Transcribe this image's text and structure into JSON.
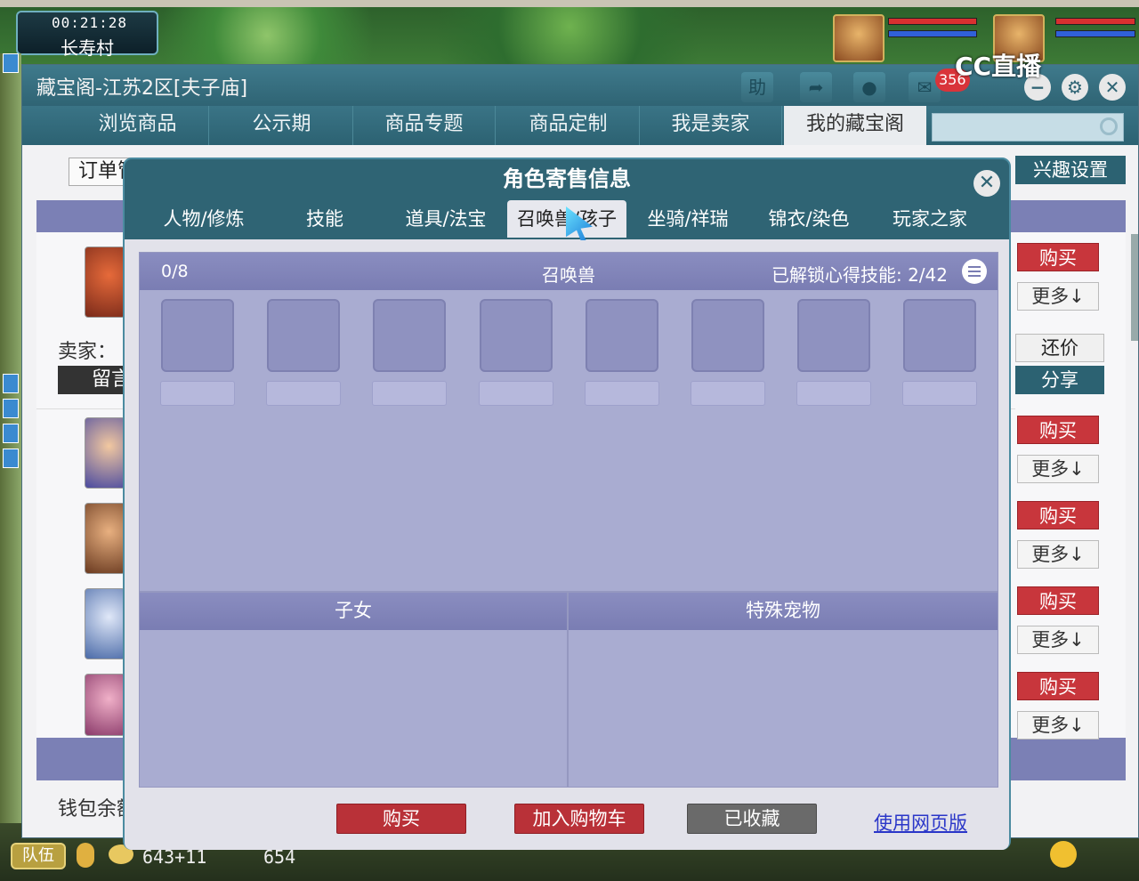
{
  "game": {
    "time": "00:21:28",
    "location": "长寿村",
    "stream_logo": "CC直播",
    "team_label": "队伍",
    "coords": "643+11",
    "coords2": "654"
  },
  "window": {
    "title": "藏宝阁-江苏2区[夫子庙]",
    "help_label": "助",
    "cart_count": "356",
    "nav": [
      "浏览商品",
      "公示期",
      "商品专题",
      "商品定制",
      "我是卖家",
      "我的藏宝阁"
    ],
    "active_nav": "我的藏宝阁",
    "search_placeholder": "",
    "order_tab": "订单管",
    "interest_settings": "兴趣设置",
    "seller_label": "卖家：",
    "message_btn": "留言",
    "bargain": "还价",
    "share": "分享",
    "buy": "购买",
    "more": "更多↓",
    "wallet": "钱包余额"
  },
  "dialog": {
    "title": "角色寄售信息",
    "tabs": [
      "人物/修炼",
      "技能",
      "道具/法宝",
      "召唤兽/孩子",
      "坐骑/祥瑞",
      "锦衣/染色",
      "玩家之家"
    ],
    "active_tab": "召唤兽/孩子",
    "pet_count": "0/8",
    "pet_label": "召唤兽",
    "skills_unlocked": "已解锁心得技能: 2/42",
    "children_label": "子女",
    "special_pets_label": "特殊宠物",
    "buy_button": "购买",
    "add_cart_button": "加入购物车",
    "favorited_button": "已收藏",
    "web_version_link": "使用网页版"
  },
  "colors": {
    "window_header": "#2f6474",
    "panel_purple": "#a9acd1",
    "buy_red": "#b93138",
    "link_blue": "#2a36c8"
  }
}
